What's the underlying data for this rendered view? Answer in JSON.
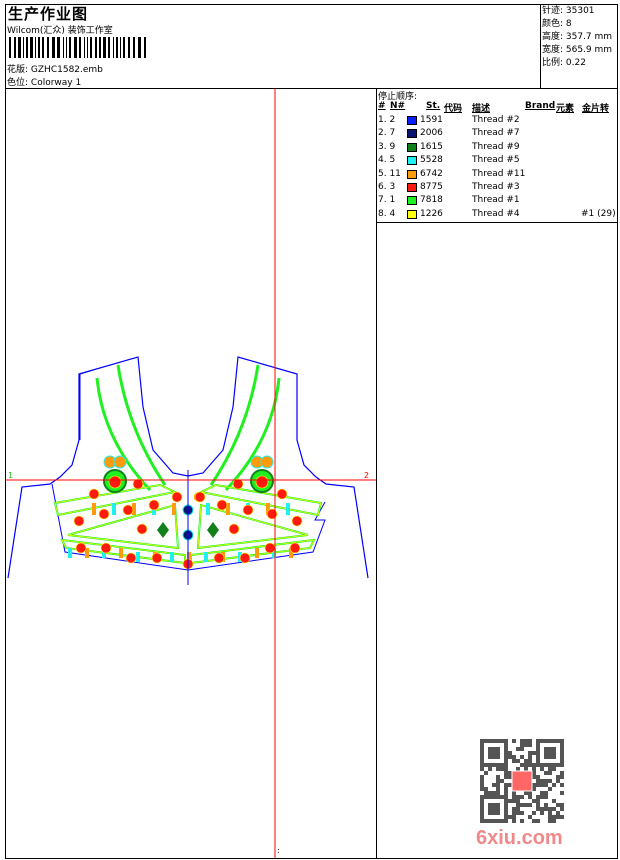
{
  "header": {
    "title": "生产作业图",
    "company": "Wilcom(汇众) 装饰工作室",
    "design_label": "花版:",
    "design_value": "GZHC1582.emb",
    "colorway_label": "色位:",
    "colorway_value": "Colorway 1"
  },
  "info": {
    "stitches": "针迹: 35301",
    "colors": "颜色: 8",
    "height": "高度: 357.7 mm",
    "width": "宽度: 565.9 mm",
    "scale": "比例: 0.22"
  },
  "sequence": {
    "title": "停止顺序:",
    "headers": {
      "num": "#",
      "n": "N#",
      "st": "St.",
      "code": "代码",
      "desc": "描述",
      "brand": "Brand",
      "element": "元素",
      "sequin": "金片转"
    },
    "rows": [
      {
        "idx": "1. 2",
        "code": "1591",
        "desc": "Thread #2",
        "color": "#0a1eff",
        "extra": ""
      },
      {
        "idx": "2. 7",
        "code": "2006",
        "desc": "Thread #7",
        "color": "#0a1470",
        "extra": ""
      },
      {
        "idx": "3. 9",
        "code": "1615",
        "desc": "Thread #9",
        "color": "#12801a",
        "extra": ""
      },
      {
        "idx": "4. 5",
        "code": "5528",
        "desc": "Thread #5",
        "color": "#20f0f0",
        "extra": ""
      },
      {
        "idx": "5. 11",
        "code": "6742",
        "desc": "Thread #11",
        "color": "#ff9a0a",
        "extra": ""
      },
      {
        "idx": "6. 3",
        "code": "8775",
        "desc": "Thread #3",
        "color": "#ff1a10",
        "extra": ""
      },
      {
        "idx": "7. 1",
        "code": "7818",
        "desc": "Thread #1",
        "color": "#20f020",
        "extra": ""
      },
      {
        "idx": "8. 4",
        "code": "1226",
        "desc": "Thread #4",
        "color": "#ffff10",
        "extra": "#1 (29)"
      }
    ]
  },
  "canvas": {
    "marker_left": "1",
    "marker_right": "2",
    "bottom_mark": ":"
  },
  "watermark": "6xiu.com",
  "colors": {
    "crosshair": "#ff0000",
    "outline": "#0000ff"
  }
}
